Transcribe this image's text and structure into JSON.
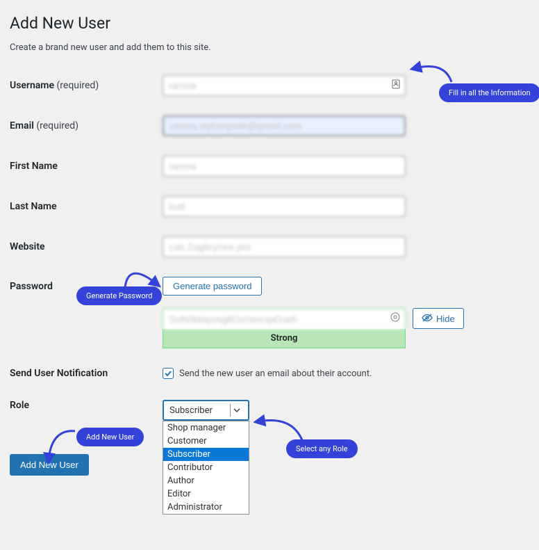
{
  "page": {
    "title": "Add New User",
    "subtitle": "Create a brand new user and add them to this site."
  },
  "fields": {
    "username": {
      "label": "Username",
      "required_text": "(required)",
      "value": "ramna"
    },
    "email": {
      "label": "Email",
      "required_text": "(required)",
      "value": "ramna.wyborgade@gmail.com"
    },
    "firstname": {
      "label": "First Name",
      "value": "ramna"
    },
    "lastname": {
      "label": "Last Name",
      "value": "butt"
    },
    "website": {
      "label": "Website",
      "value": "can.Zoglicynee.pro"
    },
    "password": {
      "label": "Password",
      "generate_button": "Generate password",
      "value": "Sclh0kbqzmg8GchserspDueh",
      "strength": "Strong",
      "hide_button": "Hide"
    },
    "notification": {
      "label": "Send User Notification",
      "checkbox_label": "Send the new user an email about their account.",
      "checked": true
    },
    "role": {
      "label": "Role",
      "selected": "Subscriber",
      "options": [
        "Shop manager",
        "Customer",
        "Subscriber",
        "Contributor",
        "Author",
        "Editor",
        "Administrator"
      ]
    }
  },
  "submit": {
    "label": "Add New User"
  },
  "callouts": {
    "fill_info": "Fill in all the Information",
    "generate_pw": "Generate Password",
    "add_new_user": "Add New User",
    "select_role": "Select any Role"
  }
}
